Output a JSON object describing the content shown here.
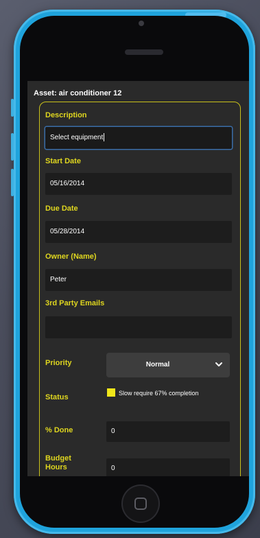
{
  "asset_title": "Asset: air conditioner 12",
  "fields": {
    "description": {
      "label": "Description",
      "value": "Select equipment"
    },
    "start_date": {
      "label": "Start Date",
      "value": "05/16/2014"
    },
    "due_date": {
      "label": "Due Date",
      "value": "05/28/2014"
    },
    "owner": {
      "label": "Owner (Name)",
      "value": "Peter"
    },
    "third_party_emails": {
      "label": "3rd Party Emails",
      "value": ""
    },
    "priority": {
      "label": "Priority",
      "value": "Normal"
    },
    "status": {
      "label": "Status",
      "value": "Slow require 67% completion",
      "color": "#f0e61a"
    },
    "percent_done": {
      "label": "% Done",
      "value": "0"
    },
    "budget_hours": {
      "label": "Budget Hours",
      "value": "0"
    }
  },
  "colors": {
    "phone_body": "#1fa3dc",
    "label_accent": "#dfd61f",
    "form_border": "#c9c21a",
    "screen_bg": "#2a2a2a"
  },
  "icons": {
    "dropdown": "chevron-down-icon",
    "home": "home-button-icon"
  }
}
